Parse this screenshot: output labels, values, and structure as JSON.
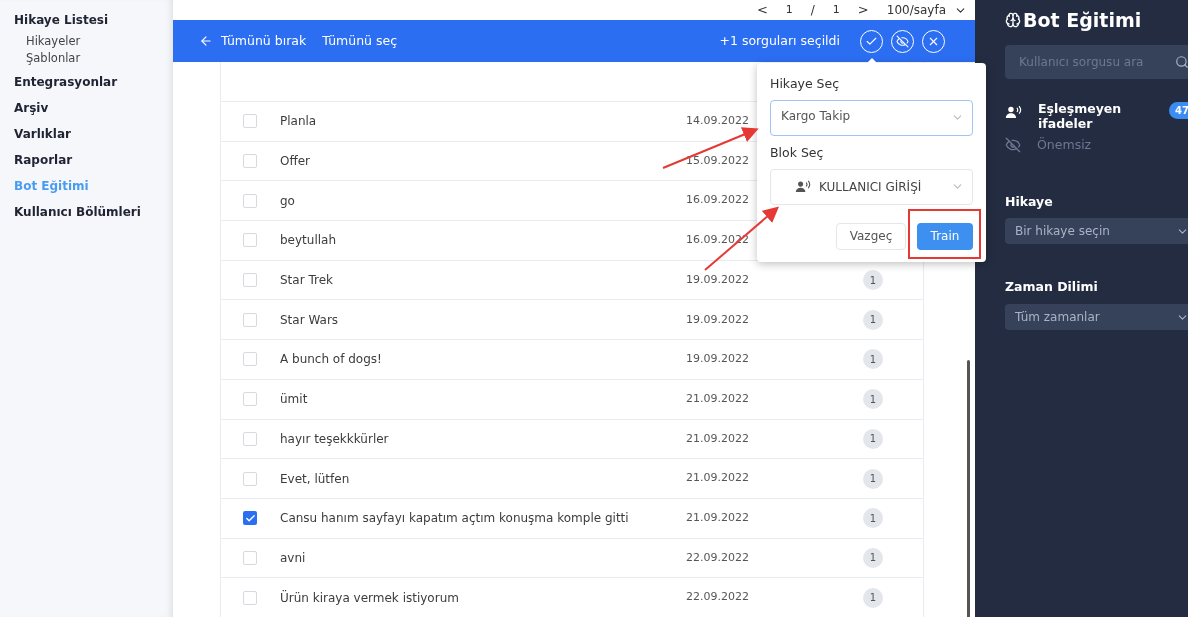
{
  "sidebar": {
    "items": [
      {
        "label": "Hikaye Listesi",
        "selected": false,
        "children": [
          {
            "label": "Hikayeler"
          },
          {
            "label": "Şablonlar"
          }
        ]
      },
      {
        "label": "Entegrasyonlar",
        "selected": false
      },
      {
        "label": "Arşiv",
        "selected": false
      },
      {
        "label": "Varlıklar",
        "selected": false
      },
      {
        "label": "Raporlar",
        "selected": false
      },
      {
        "label": "Bot Eğitimi",
        "selected": true
      },
      {
        "label": "Kullanıcı Bölümleri",
        "selected": false
      }
    ]
  },
  "pagination": {
    "prev": "<",
    "page": "1",
    "separator": "/",
    "total": "1",
    "next": ">",
    "page_size": "100/sayfa"
  },
  "selection_bar": {
    "back": "Tümünü bırak",
    "select_all": "Tümünü seç",
    "status": "+1 sorguları seçildi"
  },
  "rows": [
    {
      "text": "Planla",
      "date": "14.09.2022",
      "checked": false
    },
    {
      "text": "Offer",
      "date": "15.09.2022",
      "checked": false
    },
    {
      "text": "go",
      "date": "16.09.2022",
      "checked": false
    },
    {
      "text": "beytullah",
      "date": "16.09.2022",
      "checked": false
    },
    {
      "text": "Star Trek",
      "date": "19.09.2022",
      "checked": false,
      "count": "1"
    },
    {
      "text": "Star Wars",
      "date": "19.09.2022",
      "checked": false,
      "count": "1"
    },
    {
      "text": "A bunch of dogs!",
      "date": "19.09.2022",
      "checked": false,
      "count": "1"
    },
    {
      "text": "ümit",
      "date": "21.09.2022",
      "checked": false,
      "count": "1"
    },
    {
      "text": "hayır teşekkkürler",
      "date": "21.09.2022",
      "checked": false,
      "count": "1"
    },
    {
      "text": "Evet, lütfen",
      "date": "21.09.2022",
      "checked": false,
      "count": "1"
    },
    {
      "text": "Cansu hanım sayfayı kapatım açtım konuşma komple gitti",
      "date": "21.09.2022",
      "checked": true,
      "count": "1"
    },
    {
      "text": "avni",
      "date": "22.09.2022",
      "checked": false,
      "count": "1"
    },
    {
      "text": "Ürün kiraya vermek istiyorum",
      "date": "22.09.2022",
      "checked": false,
      "count": "1"
    }
  ],
  "popover": {
    "story_label": "Hikaye Seç",
    "story_value": "Kargo Takip",
    "block_label": "Blok Seç",
    "block_value": "KULLANICI GİRİŞİ",
    "cancel": "Vazgeç",
    "train": "Train"
  },
  "panel": {
    "title": "Bot Eğitimi",
    "search_placeholder": "Kullanıcı sorgusu ara",
    "filters": [
      {
        "label": "Eşleşmeyen ifadeler",
        "badge": "47",
        "kind": "unmatched"
      },
      {
        "label": "Önemsiz",
        "kind": "ignored"
      }
    ],
    "story_label": "Hikaye",
    "story_value": "Bir hikaye seçin",
    "time_label": "Zaman Dilimi",
    "time_value": "Tüm zamanlar"
  }
}
